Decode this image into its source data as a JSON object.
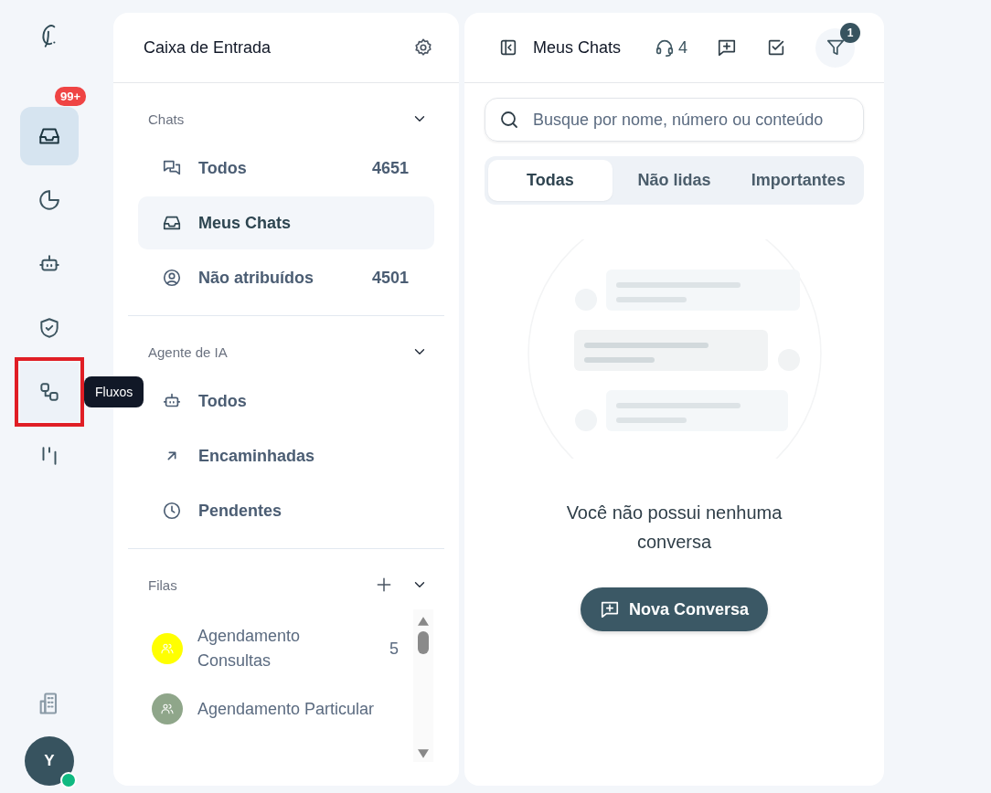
{
  "rail": {
    "items": [
      {
        "selected": true,
        "highlighted": false,
        "badge": "99+"
      },
      {
        "selected": false,
        "highlighted": false
      },
      {
        "selected": false,
        "highlighted": false
      },
      {
        "selected": false,
        "highlighted": false
      },
      {
        "selected": false,
        "highlighted": true,
        "tooltip": "Fluxos"
      },
      {
        "selected": false,
        "highlighted": false
      }
    ],
    "avatar": {
      "initial": "Y",
      "online": true
    }
  },
  "inbox": {
    "title": "Caixa de Entrada",
    "sections": [
      {
        "title": "Chats",
        "expanded": true,
        "items": [
          {
            "label": "Todos",
            "count": "4651",
            "selected": false
          },
          {
            "label": "Meus Chats",
            "selected": true
          },
          {
            "label": "Não atribuídos",
            "count": "4501",
            "selected": false
          }
        ]
      },
      {
        "title": "Agente de IA",
        "expanded": true,
        "items": [
          {
            "label": "Todos",
            "selected": false
          },
          {
            "label": "Encaminhadas",
            "selected": false
          },
          {
            "label": "Pendentes",
            "selected": false
          }
        ]
      }
    ],
    "queues": {
      "title": "Filas",
      "expanded": true,
      "items": [
        {
          "name": "Agendamento Consultas",
          "count": "5",
          "color": "#ffff00"
        },
        {
          "name": "Agendamento Particular",
          "color": "#8fa68a"
        }
      ]
    }
  },
  "chats": {
    "title": "Meus Chats",
    "agents": "4",
    "filter_badge": "1",
    "search": {
      "placeholder": "Busque por nome, número ou conteúdo"
    },
    "tabs": [
      {
        "label": "Todas",
        "selected": true
      },
      {
        "label": "Não lidas",
        "selected": false
      },
      {
        "label": "Importantes",
        "selected": false
      }
    ],
    "empty": {
      "message": "Você não possui nenhuma conversa",
      "button": "Nova Conversa"
    }
  }
}
